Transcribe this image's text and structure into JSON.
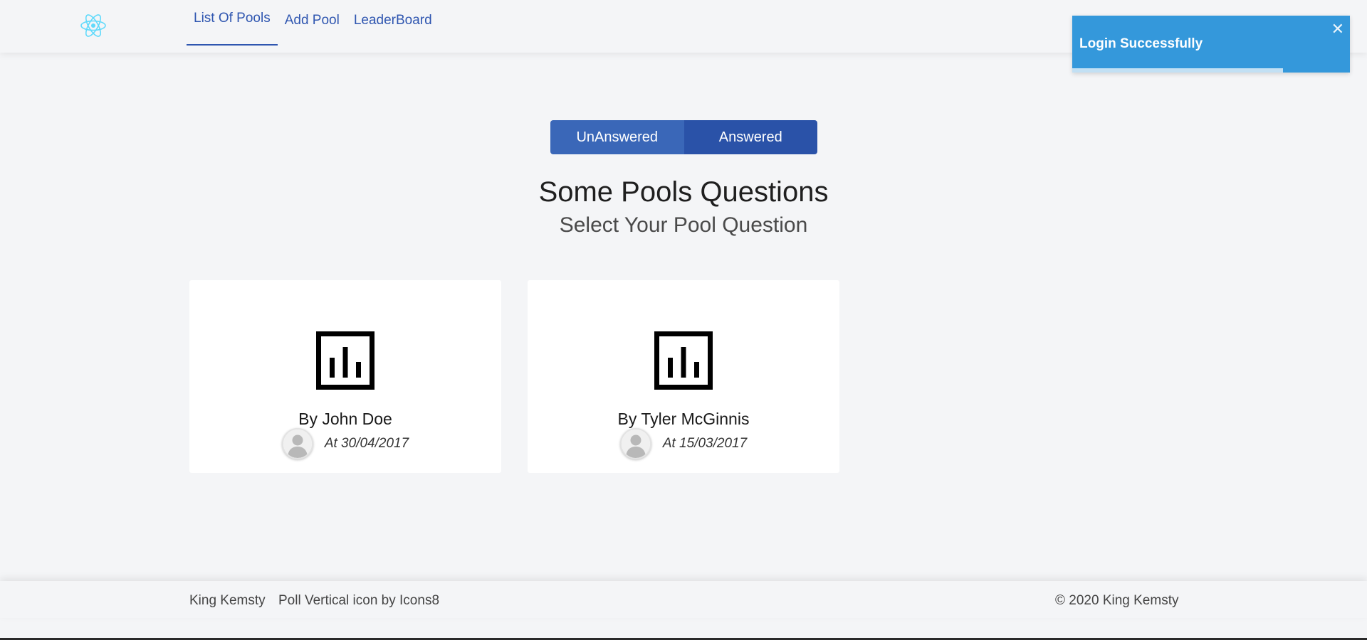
{
  "nav": {
    "logo_icon": "react-atom-icon",
    "links": [
      "List Of Pools",
      "Add Pool",
      "LeaderBoard"
    ],
    "active": "List Of Pools"
  },
  "toast": {
    "message": "Login Successfully",
    "close_icon": "close-icon",
    "progress": 0.76,
    "color": "#3498db"
  },
  "toggle": {
    "unanswered_label": "UnAnswered",
    "answered_label": "Answered"
  },
  "heading": {
    "title": "Some Pools Questions",
    "subtitle": "Select Your Pool Question"
  },
  "polls": [
    {
      "author": "By John Doe",
      "date": "At 30/04/2017",
      "icon": "poll-vertical-icon"
    },
    {
      "author": "By Tyler McGinnis",
      "date": "At 15/03/2017",
      "icon": "poll-vertical-icon"
    }
  ],
  "footer": {
    "brand": "King Kemsty",
    "credit": "Poll Vertical icon by Icons8",
    "copyright": "© 2020 King Kemsty"
  },
  "colors": {
    "accent": "#2f56b0",
    "toggle_unanswered": "#3a67b8",
    "toggle_answered": "#2a52a8",
    "react_logo": "#61dafb"
  }
}
